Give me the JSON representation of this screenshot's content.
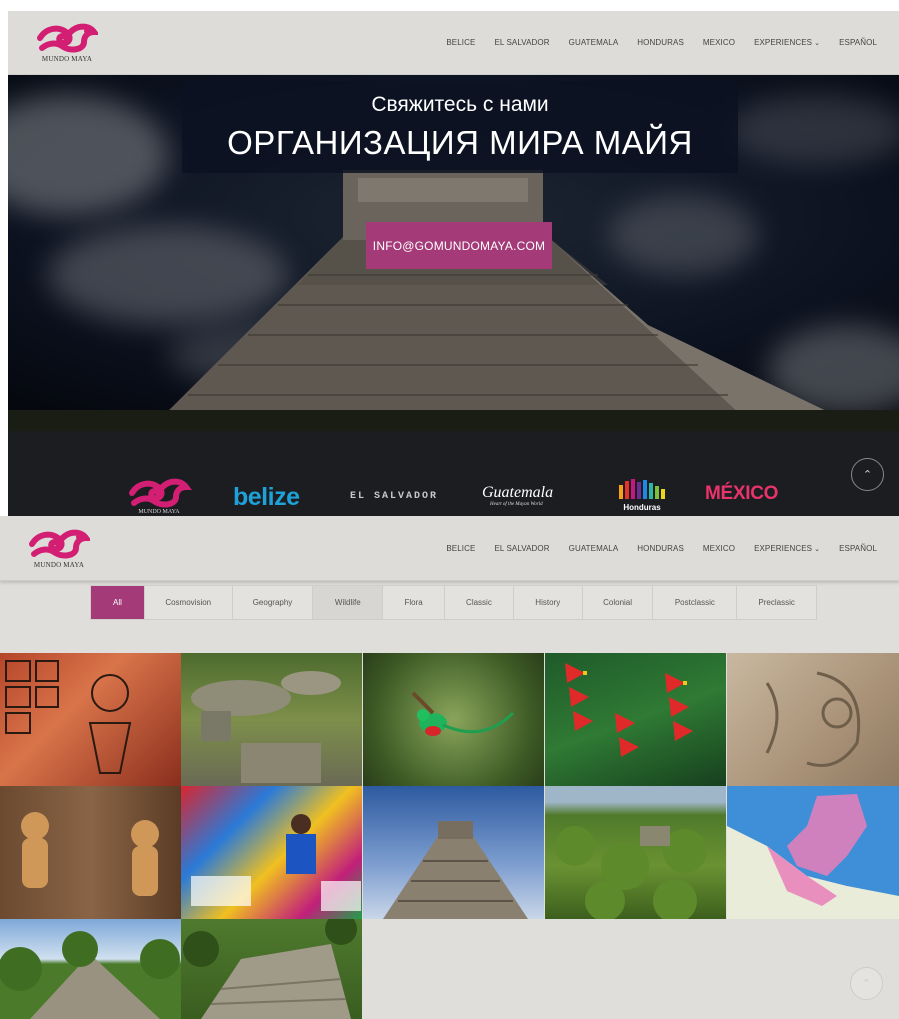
{
  "brand": {
    "name": "MUNDO MAYA",
    "color": "#d21f73"
  },
  "nav": [
    "BELICE",
    "EL SALVADOR",
    "GUATEMALA",
    "HONDURAS",
    "MEXICO",
    "EXPERIENCES",
    "ESPAÑOL"
  ],
  "hero": {
    "subtitle": "Свяжитесь с нами",
    "title": "ОРГАНИЗАЦИЯ МИРА МАЙЯ",
    "email_button": "INFO@GOMUNDOMAYA.COM",
    "accent": "#a43a78"
  },
  "partners": {
    "mundo": "MUNDO MAYA",
    "belize": "belize",
    "elsalvador": "EL SALVADOR",
    "guatemala": "Guatemala",
    "guatemala_tag": "Heart of the Mayan World",
    "honduras": "Honduras",
    "mexico": "MÉXICO"
  },
  "filters": [
    "All",
    "Cosmovision",
    "Geography",
    "Wildlife",
    "Flora",
    "Classic",
    "History",
    "Colonial",
    "Postclassic",
    "Preclassic"
  ],
  "active_filter": "All",
  "scroll_top_icon": "chevron-up-icon",
  "gallery": [
    {
      "name": "gallery-codex-painting"
    },
    {
      "name": "gallery-stone-ruins"
    },
    {
      "name": "gallery-quetzal-bird"
    },
    {
      "name": "gallery-heliconia-flowers"
    },
    {
      "name": "gallery-stone-carving"
    },
    {
      "name": "gallery-clay-figurines"
    },
    {
      "name": "gallery-textile-market"
    },
    {
      "name": "gallery-chichen-itza"
    },
    {
      "name": "gallery-jungle-canopy"
    },
    {
      "name": "gallery-region-map"
    },
    {
      "name": "gallery-jungle-pyramid"
    },
    {
      "name": "gallery-calakmul-ruins"
    }
  ]
}
